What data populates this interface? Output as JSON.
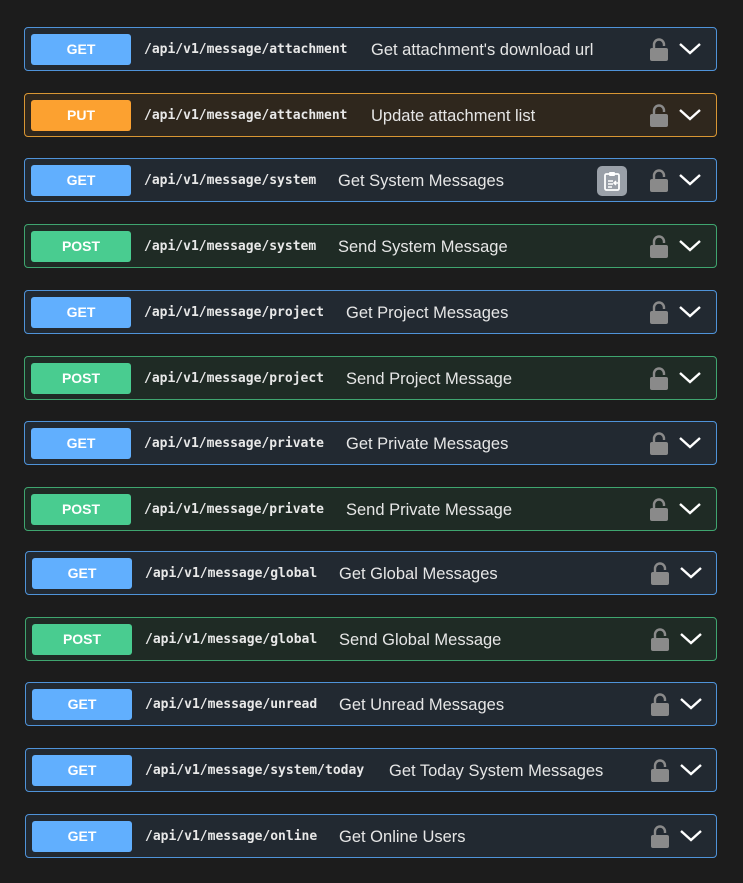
{
  "operations": [
    {
      "method": "GET",
      "path": "/api/v1/message/attachment",
      "summary": "Get attachment's download url"
    },
    {
      "method": "PUT",
      "path": "/api/v1/message/attachment",
      "summary": "Update attachment list"
    },
    {
      "method": "GET",
      "path": "/api/v1/message/system",
      "summary": "Get System Messages",
      "copy_icon": "clipboard-icon"
    },
    {
      "method": "POST",
      "path": "/api/v1/message/system",
      "summary": "Send System Message"
    },
    {
      "method": "GET",
      "path": "/api/v1/message/project",
      "summary": "Get Project Messages"
    },
    {
      "method": "POST",
      "path": "/api/v1/message/project",
      "summary": "Send Project Message"
    },
    {
      "method": "GET",
      "path": "/api/v1/message/private",
      "summary": "Get Private Messages"
    },
    {
      "method": "POST",
      "path": "/api/v1/message/private",
      "summary": "Send Private Message"
    },
    {
      "method": "GET",
      "path": "/api/v1/message/global",
      "summary": "Get Global Messages"
    },
    {
      "method": "POST",
      "path": "/api/v1/message/global",
      "summary": "Send Global Message"
    },
    {
      "method": "GET",
      "path": "/api/v1/message/unread",
      "summary": "Get Unread Messages"
    },
    {
      "method": "GET",
      "path": "/api/v1/message/system/today",
      "summary": "Get Today System Messages"
    },
    {
      "method": "GET",
      "path": "/api/v1/message/online",
      "summary": "Get Online Users"
    }
  ],
  "colors": {
    "get": "#61affe",
    "post": "#49cc90",
    "put": "#fca130",
    "background": "#1c1c1c"
  },
  "icons": {
    "lock": "lock-icon",
    "expand": "chevron-down-icon"
  }
}
